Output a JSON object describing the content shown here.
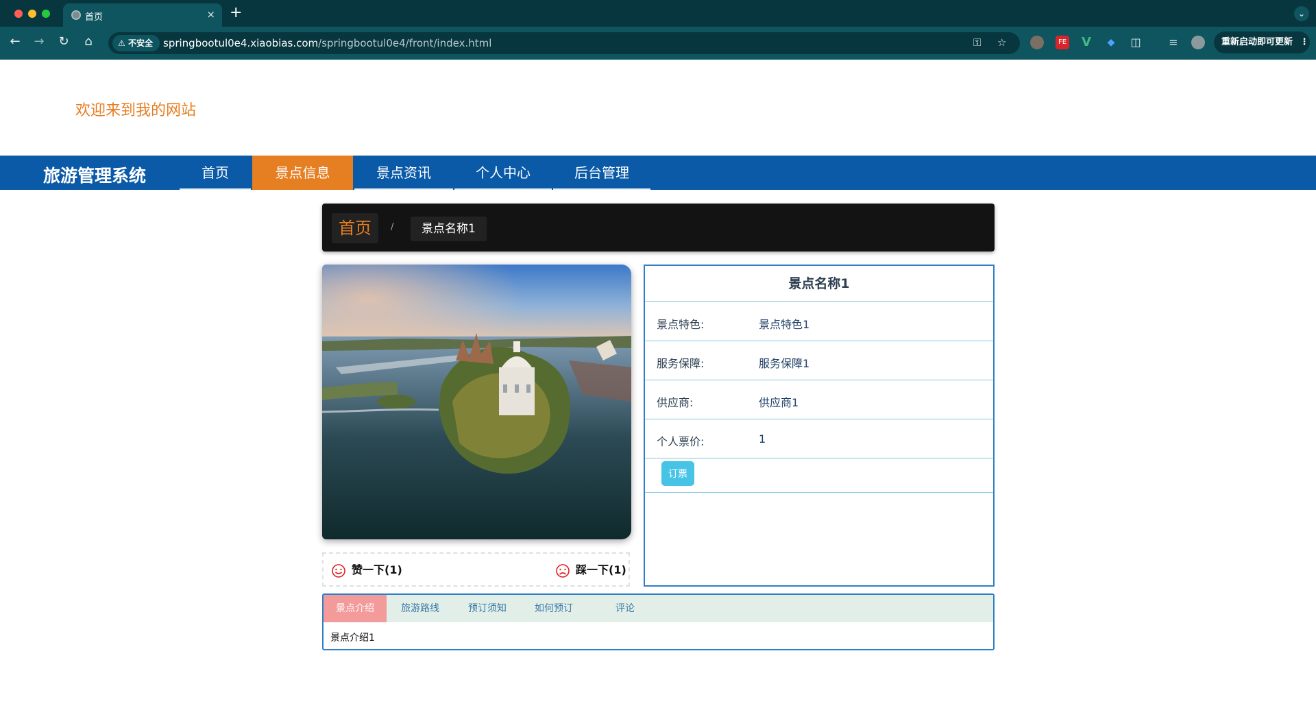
{
  "browser": {
    "tab_title": "首页",
    "close_glyph": "×",
    "new_tab_glyph": "+",
    "tab_menu_glyph": "⌄",
    "insecure_label": "不安全",
    "url_host": "springbootul0e4.xiaobias.com",
    "url_path": "/springbootul0e4/front/index.html",
    "relaunch_label": "重新启动即可更新",
    "extensions": [
      "FE"
    ]
  },
  "header": {
    "welcome": "欢迎来到我的网站"
  },
  "nav": {
    "brand": "旅游管理系统",
    "items": [
      "首页",
      "景点信息",
      "景点资讯",
      "个人中心",
      "后台管理"
    ],
    "active_index": 1
  },
  "breadcrumb": {
    "home": "首页",
    "separator": "/",
    "current": "景点名称1"
  },
  "detail": {
    "title": "景点名称1",
    "rows": [
      {
        "label": "景点特色:",
        "value": "景点特色1"
      },
      {
        "label": "服务保障:",
        "value": "服务保障1"
      },
      {
        "label": "供应商:",
        "value": "供应商1"
      },
      {
        "label": "个人票价:",
        "value": "1"
      }
    ],
    "order_button": "订票"
  },
  "votes": {
    "like": "赞一下(1)",
    "dislike": "踩一下(1)"
  },
  "tabs": {
    "items": [
      "景点介绍",
      "旅游路线",
      "预订须知",
      "如何预订",
      "评论"
    ],
    "active_index": 0,
    "content": "景点介绍1"
  },
  "colors": {
    "accent": "#e67e22",
    "navbar": "#0a5aa8",
    "border": "#2f7fc6"
  }
}
